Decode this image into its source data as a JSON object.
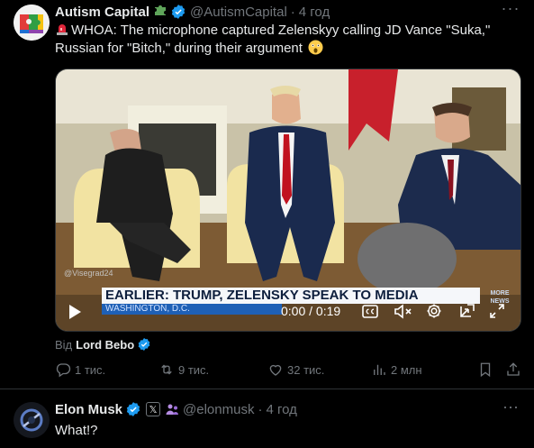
{
  "tweet": {
    "author_name": "Autism Capital",
    "author_emoji": "puzzle-piece-emoji",
    "handle": "@AutismCapital",
    "separator": "·",
    "time": "4 год",
    "more": "···",
    "text": "WHOA: The microphone captured Zelenskyy calling JD Vance \"Suka,\" Russian for \"Bitch,\" during their argument",
    "text_lead_icon": "police-light-emoji",
    "text_trail_icon": "astonished-face-emoji",
    "video": {
      "watermark": "@Visegrad24",
      "chyron_title": "EARLIER: TRUMP, ZELENSKY SPEAK TO MEDIA",
      "chyron_location": "WASHINGTON, D.C.",
      "channel_logo": "MORE NEWS",
      "timecode": "0:00 / 0:19",
      "controls": [
        "play-icon",
        "closed-captions-icon",
        "mute-icon",
        "settings-icon",
        "picture-in-picture-icon",
        "fullscreen-icon"
      ]
    },
    "from_prefix": "Від",
    "from_name": "Lord Bebo",
    "stats": {
      "replies": "1 тис.",
      "reposts": "9 тис.",
      "likes": "32 тис.",
      "views": "2 млн"
    }
  },
  "reply": {
    "author_name": "Elon Musk",
    "affiliation_badge": "𝕏",
    "handle": "@elonmusk",
    "separator": "·",
    "time": "4 год",
    "more": "···",
    "text": "What!?"
  },
  "colors": {
    "background": "#000000",
    "primary_text": "#e7e9ea",
    "secondary_text": "#71767b",
    "verified_blue": "#1d9bf0",
    "divider": "#2f3336"
  }
}
